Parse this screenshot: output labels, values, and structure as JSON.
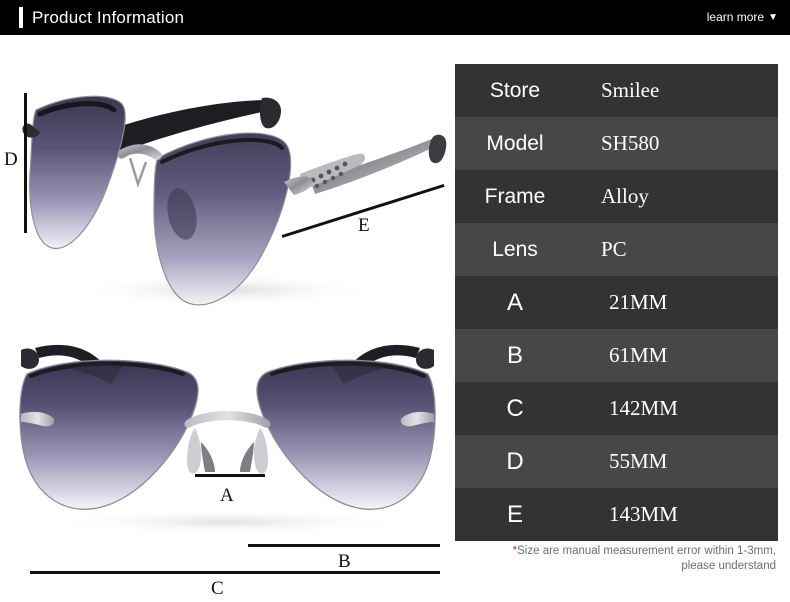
{
  "header": {
    "title": "Product Information",
    "learn_more_label": "learn more",
    "caret_glyph": "▼",
    "background_color": "#000000",
    "text_color": "#ffffff"
  },
  "product_images": {
    "angled_view": {
      "alt": "Rimless cat-eye sunglasses three-quarter angled view with gradient purple lenses and silver temple arms",
      "annotations": [
        "D",
        "E"
      ]
    },
    "front_view": {
      "alt": "Rimless cat-eye sunglasses front view with gradient purple lenses and silver bridge",
      "annotations": [
        "A",
        "B",
        "C"
      ]
    }
  },
  "measurement_labels": {
    "a": "A",
    "b": "B",
    "c": "C",
    "d": "D",
    "e": "E"
  },
  "spec_table": {
    "row_color_dark": "#333333",
    "row_color_light": "#474747",
    "rows": [
      {
        "label": "Store",
        "value": "Smilee",
        "kind": "spec"
      },
      {
        "label": "Model",
        "value": "SH580",
        "kind": "spec"
      },
      {
        "label": "Frame",
        "value": "Alloy",
        "kind": "spec"
      },
      {
        "label": "Lens",
        "value": "PC",
        "kind": "spec"
      },
      {
        "label": "A",
        "value": "21MM",
        "kind": "measure"
      },
      {
        "label": "B",
        "value": "61MM",
        "kind": "measure"
      },
      {
        "label": "C",
        "value": "142MM",
        "kind": "measure"
      },
      {
        "label": "D",
        "value": "55MM",
        "kind": "measure"
      },
      {
        "label": "E",
        "value": "143MM",
        "kind": "measure"
      }
    ]
  },
  "footnote": {
    "asterisk": "*",
    "line1": "Size are manual measurement error within 1-3mm,",
    "line2": "please understand",
    "asterisk_color": "#e0261f"
  }
}
